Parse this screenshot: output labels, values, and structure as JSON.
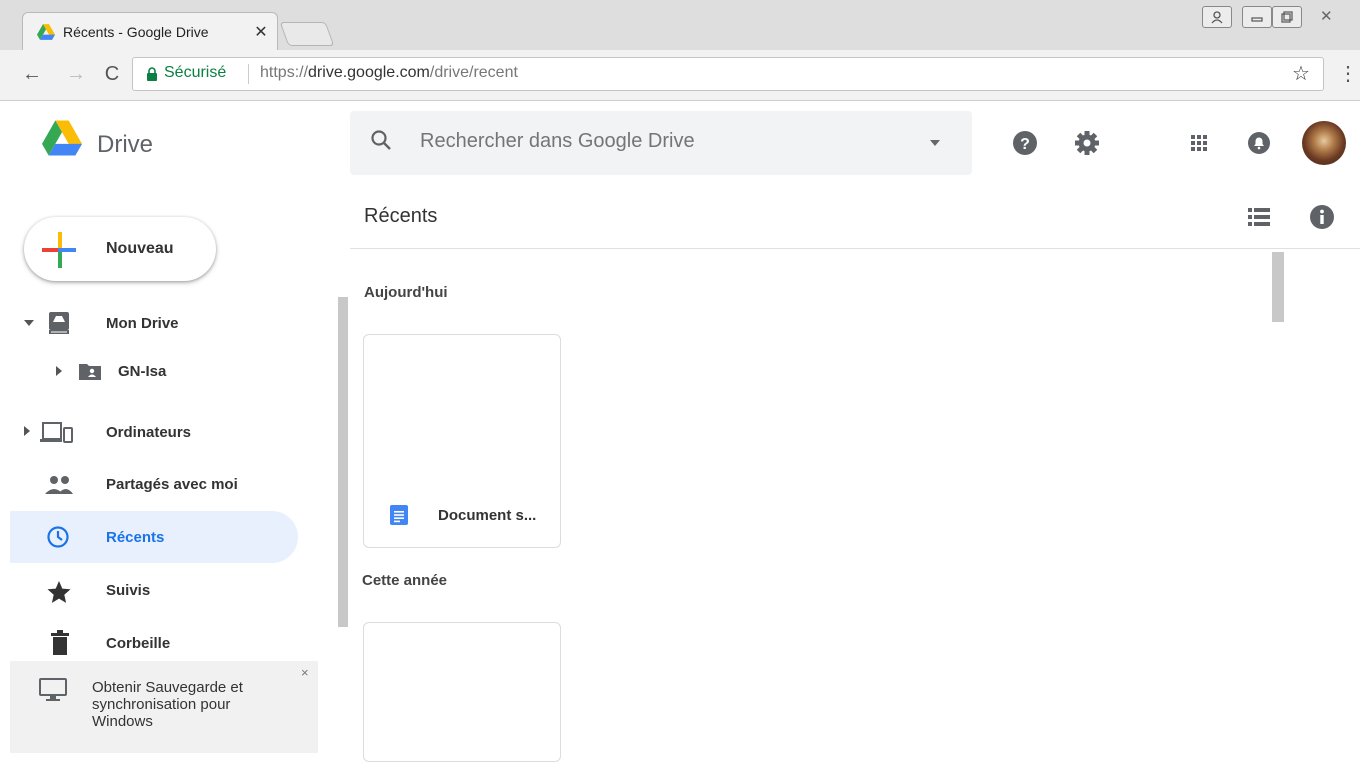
{
  "browser": {
    "tab_title": "Récents - Google Drive",
    "tab_close": "✕",
    "secure_label": "Sécurisé",
    "url_scheme": "https://",
    "url_host": "drive.google.com",
    "url_path": "/drive/recent",
    "window_buttons": [
      "⍝",
      "▭",
      "🗗",
      "✕"
    ]
  },
  "header": {
    "app_name": "Drive",
    "search_placeholder": "Rechercher dans Google Drive"
  },
  "sidebar": {
    "new_button": "Nouveau",
    "items": [
      {
        "label": "Mon Drive",
        "icon": "my-drive-icon"
      },
      {
        "label": "GN-Isa",
        "icon": "shared-folder-icon"
      },
      {
        "label": "Ordinateurs",
        "icon": "computers-icon"
      },
      {
        "label": "Partagés avec moi",
        "icon": "people-icon"
      },
      {
        "label": "Récents",
        "icon": "clock-icon"
      },
      {
        "label": "Suivis",
        "icon": "star-icon"
      },
      {
        "label": "Corbeille",
        "icon": "trash-icon"
      }
    ],
    "promo_text": "Obtenir Sauvegarde et synchronisation pour Windows",
    "promo_close": "×"
  },
  "main": {
    "title": "Récents",
    "sections": [
      {
        "label": "Aujourd'hui",
        "files": [
          {
            "name": "Document s..."
          }
        ]
      },
      {
        "label": "Cette année",
        "files": []
      }
    ]
  },
  "colors": {
    "accent": "#1a73e8",
    "active_bg": "#e8f0fe",
    "secure_green": "#0b8043"
  }
}
